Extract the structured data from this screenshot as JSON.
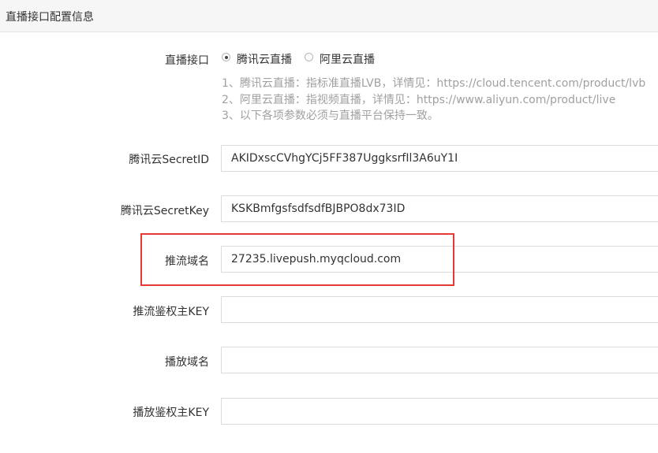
{
  "panel": {
    "title": "直播接口配置信息"
  },
  "live_interface": {
    "label": "直播接口",
    "options": [
      {
        "label": "腾讯云直播",
        "checked": true
      },
      {
        "label": "阿里云直播",
        "checked": false
      }
    ],
    "help": [
      "1、腾讯云直播：指标准直播LVB，详情见：https://cloud.tencent.com/product/lvb",
      "2、阿里云直播：指视频直播，详情见：https://www.aliyun.com/product/live",
      "3、以下各项参数必须与直播平台保持一致。"
    ]
  },
  "fields": {
    "secret_id": {
      "label": "腾讯云SecretID",
      "value": "AKIDxscCVhgYCj5FF387UggksrfIl3A6uY1I"
    },
    "secret_key": {
      "label": "腾讯云SecretKey",
      "value": "KSKBmfgsfsdfsdfBJBPO8dx73ID"
    },
    "push_domain": {
      "label": "推流域名",
      "value": "27235.livepush.myqcloud.com"
    },
    "push_auth_key": {
      "label": "推流鉴权主KEY",
      "value": ""
    },
    "play_domain": {
      "label": "播放域名",
      "value": ""
    },
    "play_auth_key": {
      "label": "播放鉴权主KEY",
      "value": ""
    }
  },
  "colors": {
    "highlight_border": "#e53935",
    "help_text": "#a0a0a0"
  }
}
